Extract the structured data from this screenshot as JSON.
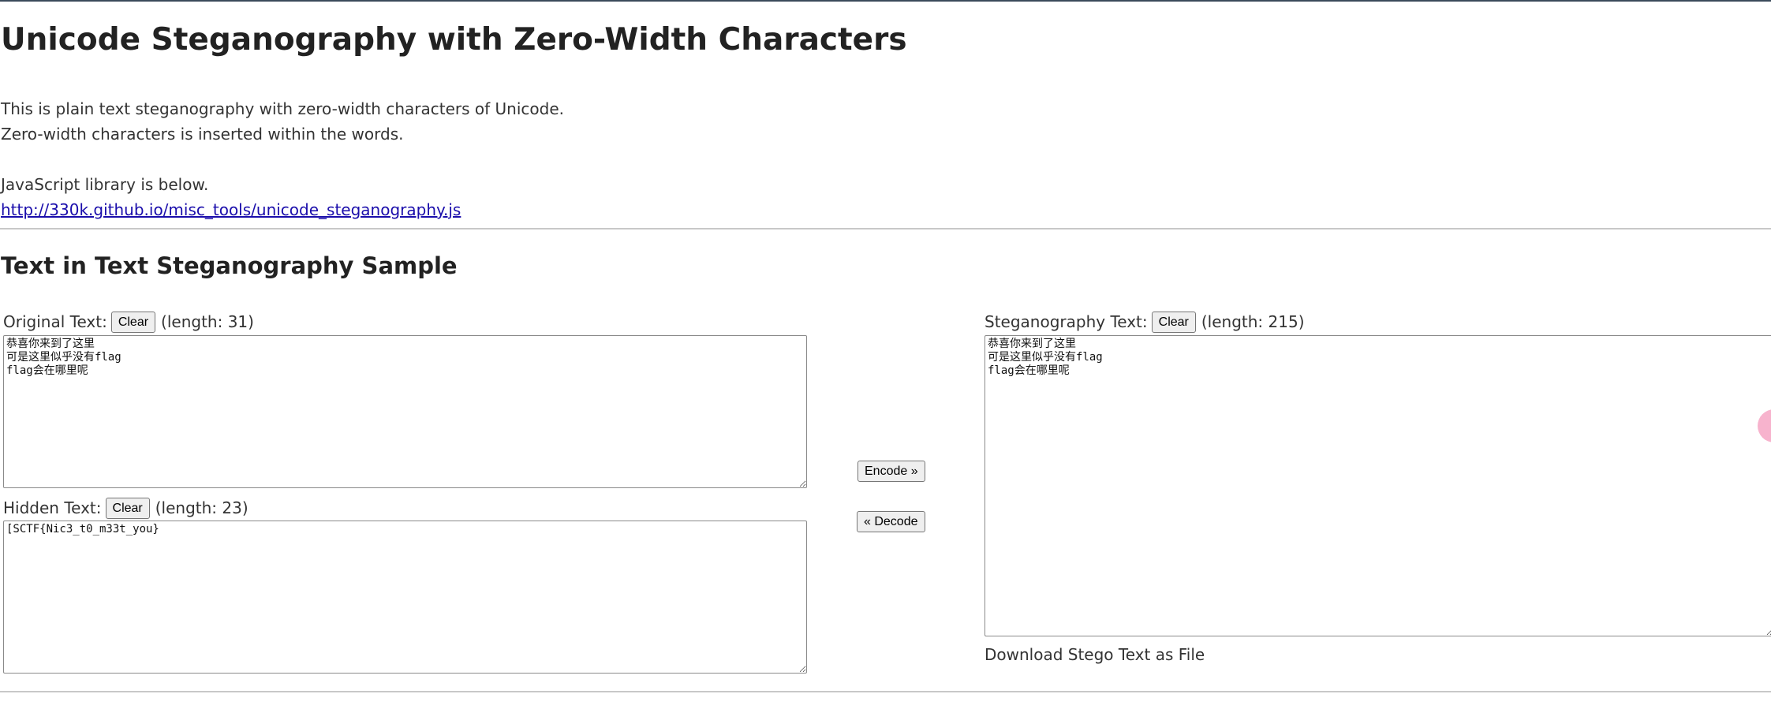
{
  "page": {
    "title": "Unicode Steganography with Zero-Width Characters",
    "intro_lines": [
      "This is plain text steganography with zero-width characters of Unicode.",
      "Zero-width characters is inserted within the words.",
      "JavaScript library is below."
    ],
    "library_link": "http://330k.github.io/misc_tools/unicode_steganography.js",
    "section_title": "Text in Text Steganography Sample"
  },
  "original": {
    "label": "Original Text:",
    "clear_label": "Clear",
    "length_text": "(length: 31)",
    "value": "恭喜你来到了这里\n可是这里似乎没有flag\nflag会在哪里呢"
  },
  "hidden": {
    "label": "Hidden Text:",
    "clear_label": "Clear",
    "length_text": "(length: 23)",
    "value": "[SCTF{Nic3_t0_m33t_you}"
  },
  "stego": {
    "label": "Steganography Text:",
    "clear_label": "Clear",
    "length_text": "(length: 215)",
    "value": "恭喜你来到了这里\n可是这里似乎没有flag\nflag会在哪里呢",
    "download_label": "Download Stego Text as File"
  },
  "actions": {
    "encode_label": "Encode »",
    "decode_label": "« Decode"
  },
  "colors": {
    "link": "#1a0dab",
    "accent_blob": "#f7b3cd"
  }
}
